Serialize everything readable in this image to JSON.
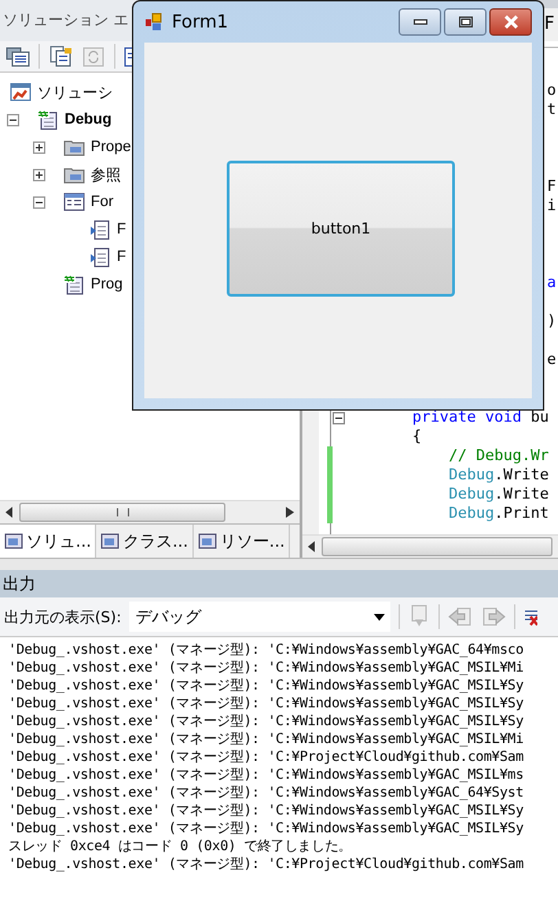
{
  "solution_explorer": {
    "title": "ソリューション エ",
    "tree": [
      {
        "label": "ソリューシ",
        "kind": "solution",
        "children": [
          {
            "label": "Debug",
            "kind": "project",
            "expanded": true,
            "children": [
              {
                "label": "Prope",
                "kind": "properties",
                "expanded": false
              },
              {
                "label": "参照",
                "kind": "references",
                "expanded": false
              },
              {
                "label": "For",
                "kind": "form",
                "expanded": true,
                "children": [
                  {
                    "label": "F",
                    "kind": "file"
                  },
                  {
                    "label": "F",
                    "kind": "file"
                  }
                ]
              },
              {
                "label": "Prog",
                "kind": "csfile"
              }
            ]
          }
        ]
      }
    ],
    "tabs": [
      {
        "label": "ソリュ...",
        "selected": true
      },
      {
        "label": "クラス...",
        "selected": false
      },
      {
        "label": "リソー...",
        "selected": false
      }
    ]
  },
  "editor": {
    "tab": "F",
    "lines": [
      {
        "kind": "tail",
        "tokens": [
          {
            "text": "o",
            "kind": "plain"
          }
        ]
      },
      {
        "kind": "tail",
        "tokens": [
          {
            "text": "t",
            "kind": "plain"
          }
        ]
      },
      {
        "kind": "blank"
      },
      {
        "kind": "blank"
      },
      {
        "kind": "blank"
      },
      {
        "kind": "tail",
        "tokens": [
          {
            "text": "F",
            "kind": "plain"
          }
        ]
      },
      {
        "kind": "tail",
        "tokens": [
          {
            "text": "i",
            "kind": "plain"
          }
        ]
      },
      {
        "kind": "blank"
      },
      {
        "kind": "blank"
      },
      {
        "kind": "blank"
      },
      {
        "kind": "tail",
        "tokens": [
          {
            "text": "a",
            "kind": "keyword"
          }
        ]
      },
      {
        "kind": "blank"
      },
      {
        "kind": "tail",
        "tokens": [
          {
            "text": ")",
            "kind": "plain"
          }
        ]
      },
      {
        "kind": "blank"
      },
      {
        "kind": "tail",
        "tokens": [
          {
            "text": "e",
            "kind": "plain"
          }
        ]
      },
      {
        "kind": "blank"
      },
      {
        "kind": "blank"
      },
      {
        "kind": "code",
        "fold_expanded": true,
        "tokens": [
          {
            "text": "private void",
            "kind": "keyword"
          },
          {
            "text": " bu",
            "kind": "plain"
          }
        ]
      },
      {
        "kind": "code",
        "tokens": [
          {
            "text": "{",
            "kind": "plain"
          }
        ]
      },
      {
        "kind": "code",
        "changed": true,
        "tokens": [
          {
            "text": "    // Debug.Wr",
            "kind": "comment"
          }
        ]
      },
      {
        "kind": "code",
        "changed": true,
        "tokens": [
          {
            "text": "    Debug",
            "kind": "type"
          },
          {
            "text": ".Write",
            "kind": "plain"
          }
        ]
      },
      {
        "kind": "code",
        "changed": true,
        "tokens": [
          {
            "text": "    Debug",
            "kind": "type"
          },
          {
            "text": ".Write",
            "kind": "plain"
          }
        ]
      },
      {
        "kind": "code",
        "changed": true,
        "tokens": [
          {
            "text": "    Debug",
            "kind": "type"
          },
          {
            "text": ".Print",
            "kind": "plain"
          }
        ]
      }
    ]
  },
  "output": {
    "title": "出力",
    "source_label": "出力元の表示(S):",
    "source_value": "デバッグ",
    "lines": [
      "'Debug_.vshost.exe' (マネージ型): 'C:¥Windows¥assembly¥GAC_64¥msco",
      "'Debug_.vshost.exe' (マネージ型): 'C:¥Windows¥assembly¥GAC_MSIL¥Mi",
      "'Debug_.vshost.exe' (マネージ型): 'C:¥Windows¥assembly¥GAC_MSIL¥Sy",
      "'Debug_.vshost.exe' (マネージ型): 'C:¥Windows¥assembly¥GAC_MSIL¥Sy",
      "'Debug_.vshost.exe' (マネージ型): 'C:¥Windows¥assembly¥GAC_MSIL¥Sy",
      "'Debug_.vshost.exe' (マネージ型): 'C:¥Windows¥assembly¥GAC_MSIL¥Mi",
      "'Debug_.vshost.exe' (マネージ型): 'C:¥Project¥Cloud¥github.com¥Sam",
      "'Debug_.vshost.exe' (マネージ型): 'C:¥Windows¥assembly¥GAC_MSIL¥ms",
      "'Debug_.vshost.exe' (マネージ型): 'C:¥Windows¥assembly¥GAC_64¥Syst",
      "'Debug_.vshost.exe' (マネージ型): 'C:¥Windows¥assembly¥GAC_MSIL¥Sy",
      "'Debug_.vshost.exe' (マネージ型): 'C:¥Windows¥assembly¥GAC_MSIL¥Sy",
      "スレッド 0xce4 はコード 0 (0x0) で終了しました。",
      "'Debug_.vshost.exe' (マネージ型): 'C:¥Project¥Cloud¥github.com¥Sam"
    ]
  },
  "form": {
    "title": "Form1",
    "button": "button1"
  }
}
